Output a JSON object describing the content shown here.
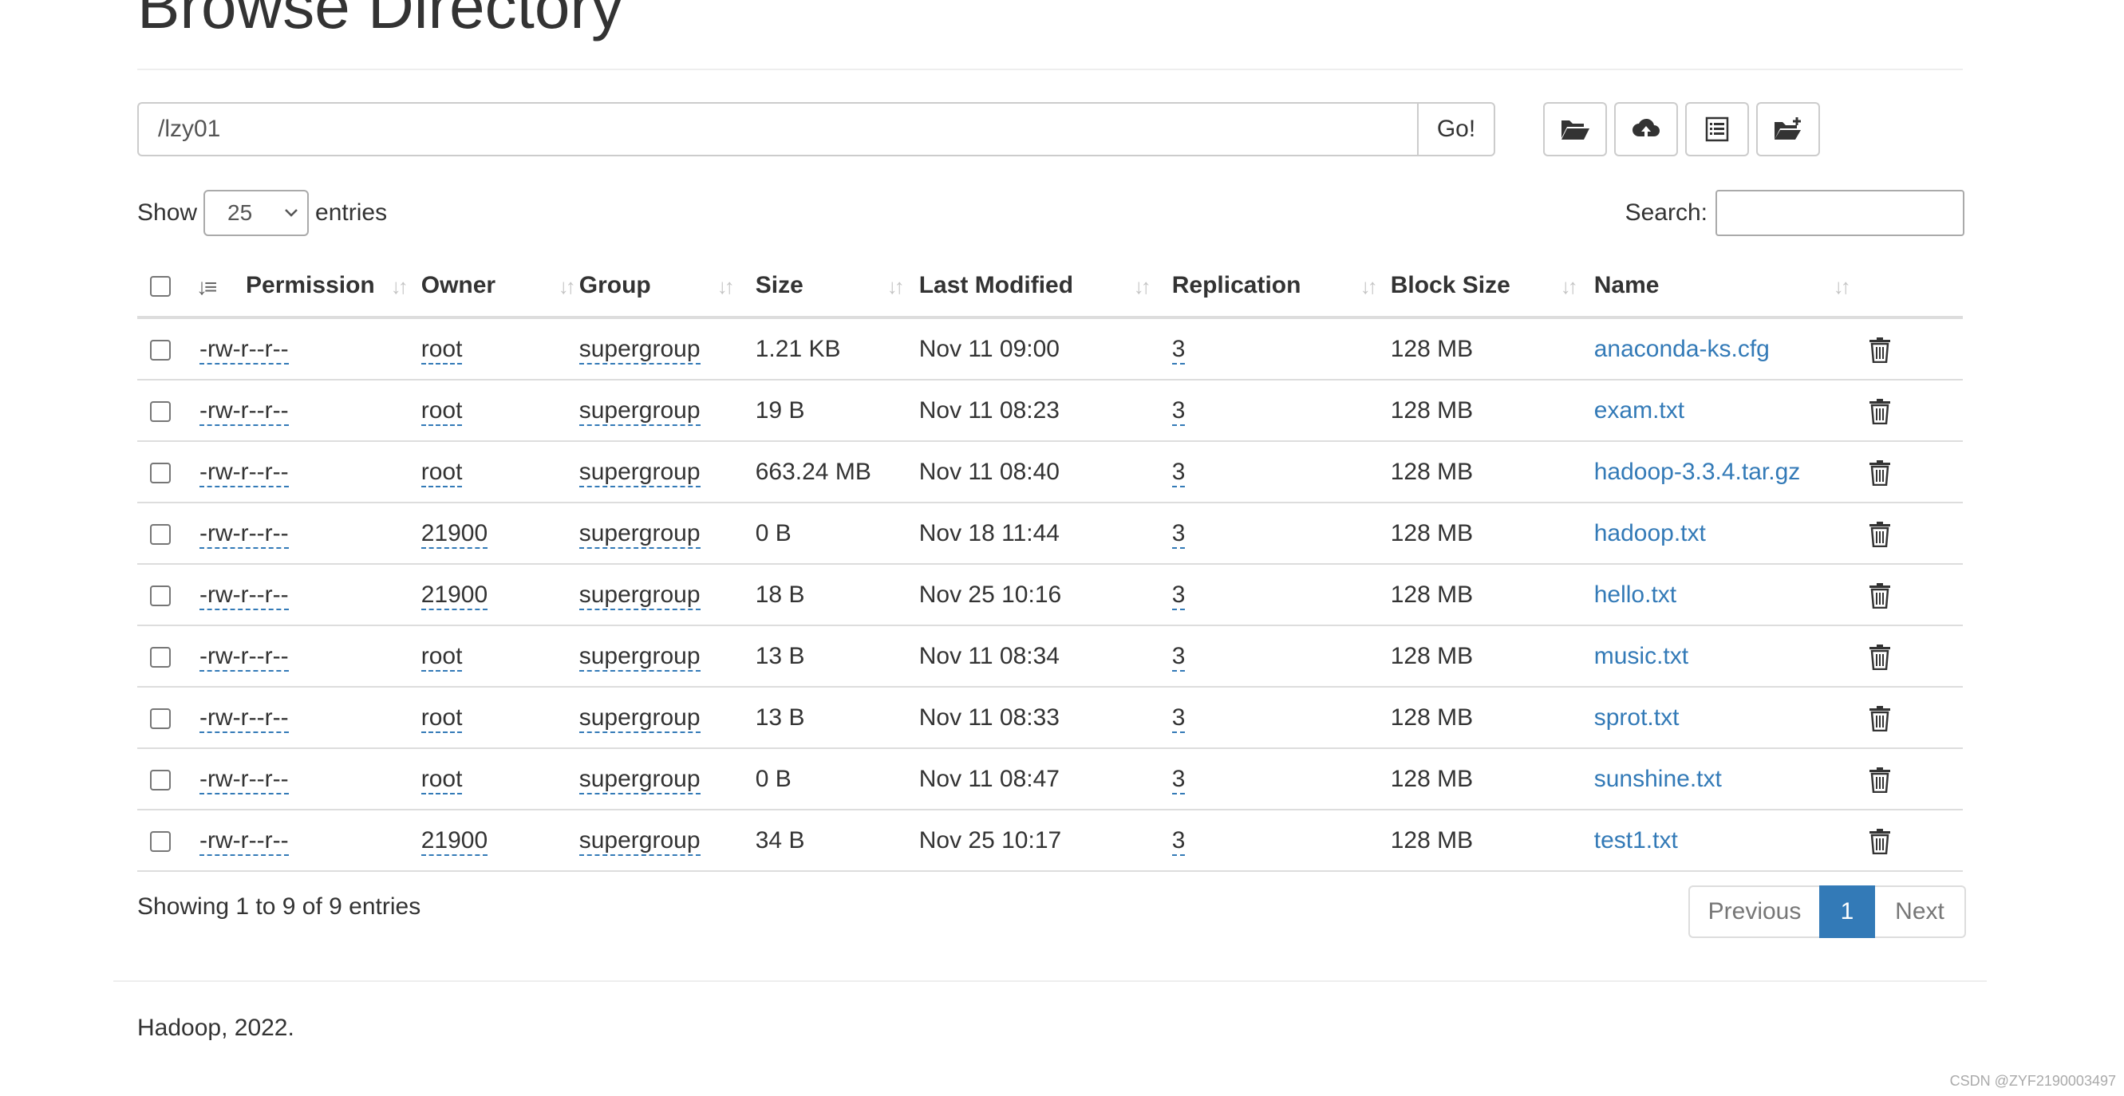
{
  "page": {
    "title": "Browse Directory"
  },
  "pathbar": {
    "path_value": "/lzy01",
    "go_label": "Go!"
  },
  "toolbar": {
    "icons": [
      "folder-open-icon",
      "cloud-upload-icon",
      "list-icon",
      "folder-add-icon"
    ]
  },
  "entries": {
    "show_label": "Show",
    "selected_value": "25",
    "entries_label": "entries",
    "search_label": "Search:",
    "search_value": ""
  },
  "table": {
    "columns": [
      "Permission",
      "Owner",
      "Group",
      "Size",
      "Last Modified",
      "Replication",
      "Block Size",
      "Name"
    ],
    "rows": [
      {
        "permission": "-rw-r--r--",
        "owner": "root",
        "group": "supergroup",
        "size": "1.21 KB",
        "modified": "Nov 11 09:00",
        "replication": "3",
        "block_size": "128 MB",
        "name": "anaconda-ks.cfg"
      },
      {
        "permission": "-rw-r--r--",
        "owner": "root",
        "group": "supergroup",
        "size": "19 B",
        "modified": "Nov 11 08:23",
        "replication": "3",
        "block_size": "128 MB",
        "name": "exam.txt"
      },
      {
        "permission": "-rw-r--r--",
        "owner": "root",
        "group": "supergroup",
        "size": "663.24 MB",
        "modified": "Nov 11 08:40",
        "replication": "3",
        "block_size": "128 MB",
        "name": "hadoop-3.3.4.tar.gz"
      },
      {
        "permission": "-rw-r--r--",
        "owner": "21900",
        "group": "supergroup",
        "size": "0 B",
        "modified": "Nov 18 11:44",
        "replication": "3",
        "block_size": "128 MB",
        "name": "hadoop.txt"
      },
      {
        "permission": "-rw-r--r--",
        "owner": "21900",
        "group": "supergroup",
        "size": "18 B",
        "modified": "Nov 25 10:16",
        "replication": "3",
        "block_size": "128 MB",
        "name": "hello.txt"
      },
      {
        "permission": "-rw-r--r--",
        "owner": "root",
        "group": "supergroup",
        "size": "13 B",
        "modified": "Nov 11 08:34",
        "replication": "3",
        "block_size": "128 MB",
        "name": "music.txt"
      },
      {
        "permission": "-rw-r--r--",
        "owner": "root",
        "group": "supergroup",
        "size": "13 B",
        "modified": "Nov 11 08:33",
        "replication": "3",
        "block_size": "128 MB",
        "name": "sprot.txt"
      },
      {
        "permission": "-rw-r--r--",
        "owner": "root",
        "group": "supergroup",
        "size": "0 B",
        "modified": "Nov 11 08:47",
        "replication": "3",
        "block_size": "128 MB",
        "name": "sunshine.txt"
      },
      {
        "permission": "-rw-r--r--",
        "owner": "21900",
        "group": "supergroup",
        "size": "34 B",
        "modified": "Nov 25 10:17",
        "replication": "3",
        "block_size": "128 MB",
        "name": "test1.txt"
      }
    ]
  },
  "table_footer": {
    "showing_text": "Showing 1 to 9 of 9 entries",
    "previous_label": "Previous",
    "current_page": "1",
    "next_label": "Next"
  },
  "footer": {
    "copyright": "Hadoop, 2022."
  },
  "watermark": {
    "text": "CSDN @ZYF2190003497"
  },
  "colors": {
    "link": "#337ab7",
    "active_page": "#337ab7",
    "border": "#dddddd"
  }
}
